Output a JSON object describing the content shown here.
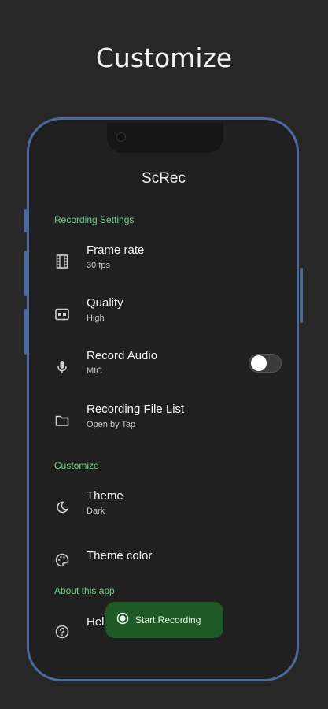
{
  "promo": {
    "title": "Customize"
  },
  "app": {
    "title": "ScRec"
  },
  "sections": {
    "recording": "Recording Settings",
    "customize": "Customize",
    "about": "About this app"
  },
  "settings": {
    "frame_rate": {
      "label": "Frame rate",
      "value": "30 fps",
      "icon": "film-icon"
    },
    "quality": {
      "label": "Quality",
      "value": "High",
      "icon": "hd-icon"
    },
    "record_audio": {
      "label": "Record Audio",
      "value": "MIC",
      "icon": "mic-icon",
      "toggle_on": false
    },
    "file_list": {
      "label": "Recording File List",
      "value": "Open by Tap",
      "icon": "folder-icon"
    },
    "theme": {
      "label": "Theme",
      "value": "Dark",
      "icon": "moon-icon"
    },
    "theme_color": {
      "label": "Theme color",
      "icon": "palette-icon"
    },
    "help": {
      "label": "Hel",
      "icon": "help-icon"
    }
  },
  "fab": {
    "label": "Start Recording",
    "icon": "record-icon"
  },
  "colors": {
    "accent": "#6fd08a",
    "fab_bg": "#1f5a26",
    "frame": "#4a6a9e",
    "background": "#272727"
  }
}
